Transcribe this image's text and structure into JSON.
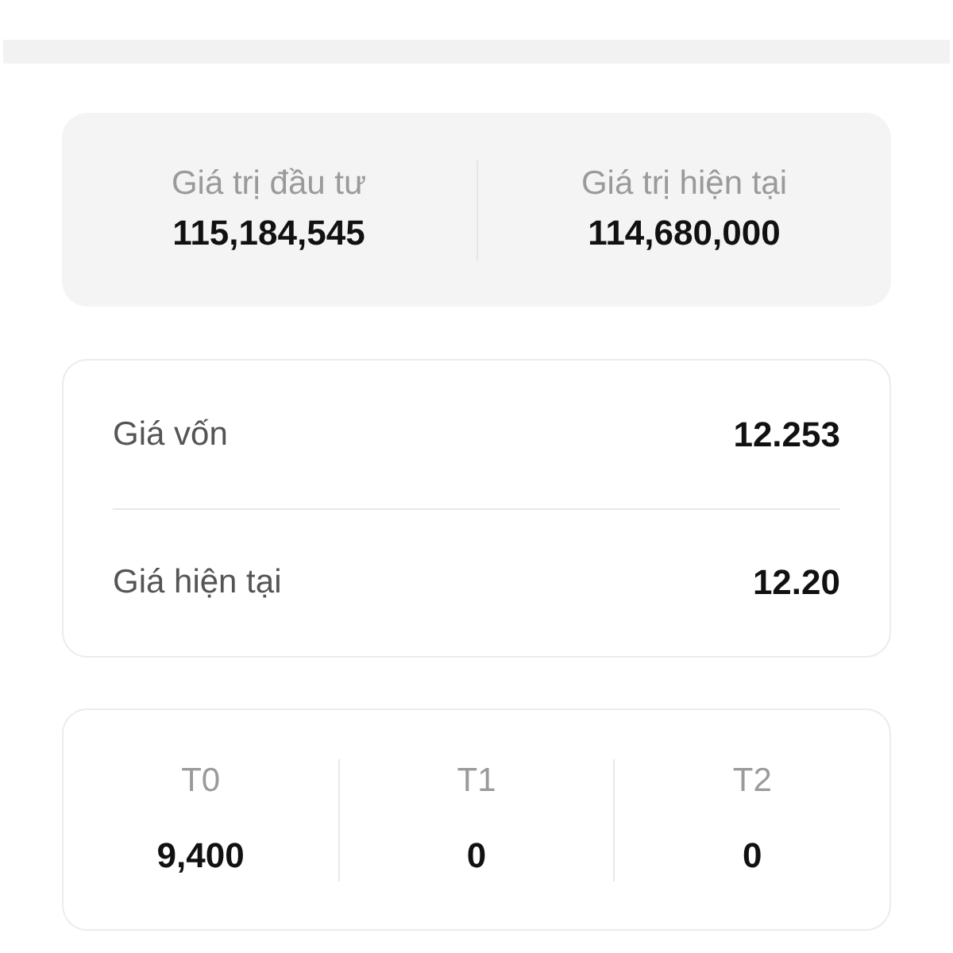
{
  "summary": [
    {
      "label": "Giá trị đầu tư",
      "value": "115,184,545"
    },
    {
      "label": "Giá trị hiện tại",
      "value": "114,680,000"
    }
  ],
  "prices": [
    {
      "label": "Giá vốn",
      "value": "12.253"
    },
    {
      "label": "Giá hiện tại",
      "value": "12.20"
    }
  ],
  "settlement": [
    {
      "label": "T0",
      "value": "9,400"
    },
    {
      "label": "T1",
      "value": "0"
    },
    {
      "label": "T2",
      "value": "0"
    }
  ]
}
